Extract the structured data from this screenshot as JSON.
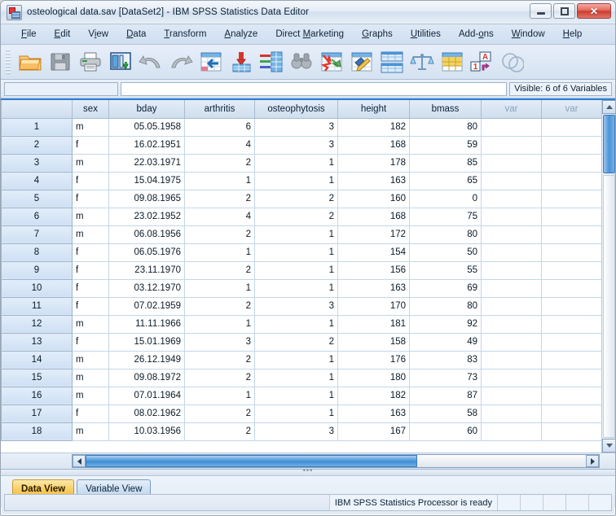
{
  "window": {
    "title": "osteological data.sav [DataSet2] - IBM SPSS Statistics Data Editor",
    "app_icon": "spss-app-icon",
    "minimize_label": "–",
    "maximize_label": "❐",
    "close_label": "✕"
  },
  "menu": {
    "items": [
      {
        "label": "File",
        "accel": "F"
      },
      {
        "label": "Edit",
        "accel": "E"
      },
      {
        "label": "View",
        "accel": "V"
      },
      {
        "label": "Data",
        "accel": "D"
      },
      {
        "label": "Transform",
        "accel": "T"
      },
      {
        "label": "Analyze",
        "accel": "A"
      },
      {
        "label": "Direct Marketing",
        "accel": "M"
      },
      {
        "label": "Graphs",
        "accel": "G"
      },
      {
        "label": "Utilities",
        "accel": "U"
      },
      {
        "label": "Add-ons",
        "accel": "o"
      },
      {
        "label": "Window",
        "accel": "W"
      },
      {
        "label": "Help",
        "accel": "H"
      }
    ]
  },
  "toolbar": {
    "buttons": [
      {
        "name": "open-file-icon",
        "title": "Open data document"
      },
      {
        "name": "save-icon",
        "title": "Save this document"
      },
      {
        "name": "print-icon",
        "title": "Print"
      },
      {
        "name": "recall-dialogs-icon",
        "title": "Recall recently used dialogs"
      },
      {
        "name": "undo-icon",
        "title": "Undo a user action"
      },
      {
        "name": "redo-icon",
        "title": "Redo a user action"
      },
      {
        "name": "goto-case-icon",
        "title": "Go to case"
      },
      {
        "name": "goto-variable-icon",
        "title": "Go to variable"
      },
      {
        "name": "variables-icon",
        "title": "Variables"
      },
      {
        "name": "find-icon",
        "title": "Find"
      },
      {
        "name": "insert-case-icon",
        "title": "Insert cases"
      },
      {
        "name": "insert-variable-icon",
        "title": "Insert variable"
      },
      {
        "name": "split-file-icon",
        "title": "Split file"
      },
      {
        "name": "weight-cases-icon",
        "title": "Weight cases"
      },
      {
        "name": "select-cases-icon",
        "title": "Select cases"
      },
      {
        "name": "value-labels-icon",
        "title": "Value labels"
      },
      {
        "name": "use-variable-sets-icon",
        "title": "Use variable sets"
      }
    ]
  },
  "editor_strip": {
    "name_value": "",
    "cell_value": "",
    "visible_variables": "Visible: 6 of 6 Variables"
  },
  "grid": {
    "columns": [
      {
        "label": "",
        "type": "rowheader"
      },
      {
        "label": "sex",
        "type": "text"
      },
      {
        "label": "bday",
        "type": "date"
      },
      {
        "label": "arthritis",
        "type": "number"
      },
      {
        "label": "osteophytosis",
        "type": "number"
      },
      {
        "label": "height",
        "type": "number"
      },
      {
        "label": "bmass",
        "type": "number"
      },
      {
        "label": "var",
        "type": "empty"
      },
      {
        "label": "var",
        "type": "empty"
      }
    ],
    "rows": [
      {
        "n": "1",
        "sex": "m",
        "bday": "05.05.1958",
        "arthritis": "6",
        "osteophytosis": "3",
        "height": "182",
        "bmass": "80"
      },
      {
        "n": "2",
        "sex": "f",
        "bday": "16.02.1951",
        "arthritis": "4",
        "osteophytosis": "3",
        "height": "168",
        "bmass": "59"
      },
      {
        "n": "3",
        "sex": "m",
        "bday": "22.03.1971",
        "arthritis": "2",
        "osteophytosis": "1",
        "height": "178",
        "bmass": "85"
      },
      {
        "n": "4",
        "sex": "f",
        "bday": "15.04.1975",
        "arthritis": "1",
        "osteophytosis": "1",
        "height": "163",
        "bmass": "65"
      },
      {
        "n": "5",
        "sex": "f",
        "bday": "09.08.1965",
        "arthritis": "2",
        "osteophytosis": "2",
        "height": "160",
        "bmass": "0"
      },
      {
        "n": "6",
        "sex": "m",
        "bday": "23.02.1952",
        "arthritis": "4",
        "osteophytosis": "2",
        "height": "168",
        "bmass": "75"
      },
      {
        "n": "7",
        "sex": "m",
        "bday": "06.08.1956",
        "arthritis": "2",
        "osteophytosis": "1",
        "height": "172",
        "bmass": "80"
      },
      {
        "n": "8",
        "sex": "f",
        "bday": "06.05.1976",
        "arthritis": "1",
        "osteophytosis": "1",
        "height": "154",
        "bmass": "50"
      },
      {
        "n": "9",
        "sex": "f",
        "bday": "23.11.1970",
        "arthritis": "2",
        "osteophytosis": "1",
        "height": "156",
        "bmass": "55"
      },
      {
        "n": "10",
        "sex": "f",
        "bday": "03.12.1970",
        "arthritis": "1",
        "osteophytosis": "1",
        "height": "163",
        "bmass": "69"
      },
      {
        "n": "11",
        "sex": "f",
        "bday": "07.02.1959",
        "arthritis": "2",
        "osteophytosis": "3",
        "height": "170",
        "bmass": "80"
      },
      {
        "n": "12",
        "sex": "m",
        "bday": "11.11.1966",
        "arthritis": "1",
        "osteophytosis": "1",
        "height": "181",
        "bmass": "92"
      },
      {
        "n": "13",
        "sex": "f",
        "bday": "15.01.1969",
        "arthritis": "3",
        "osteophytosis": "2",
        "height": "158",
        "bmass": "49"
      },
      {
        "n": "14",
        "sex": "m",
        "bday": "26.12.1949",
        "arthritis": "2",
        "osteophytosis": "1",
        "height": "176",
        "bmass": "83"
      },
      {
        "n": "15",
        "sex": "m",
        "bday": "09.08.1972",
        "arthritis": "2",
        "osteophytosis": "1",
        "height": "180",
        "bmass": "73"
      },
      {
        "n": "16",
        "sex": "m",
        "bday": "07.01.1964",
        "arthritis": "1",
        "osteophytosis": "1",
        "height": "182",
        "bmass": "87"
      },
      {
        "n": "17",
        "sex": "f",
        "bday": "08.02.1962",
        "arthritis": "2",
        "osteophytosis": "1",
        "height": "163",
        "bmass": "58"
      },
      {
        "n": "18",
        "sex": "m",
        "bday": "10.03.1956",
        "arthritis": "2",
        "osteophytosis": "3",
        "height": "167",
        "bmass": "60"
      }
    ]
  },
  "tabs": [
    {
      "label": "Data View",
      "active": true
    },
    {
      "label": "Variable View",
      "active": false
    }
  ],
  "statusbar": {
    "message": "IBM SPSS Statistics Processor is ready"
  },
  "colors": {
    "accent_blue": "#2b7fd4",
    "active_tab": "#f7c85a",
    "header_blue": "#cfdeef",
    "close_red": "#c93d2d"
  }
}
